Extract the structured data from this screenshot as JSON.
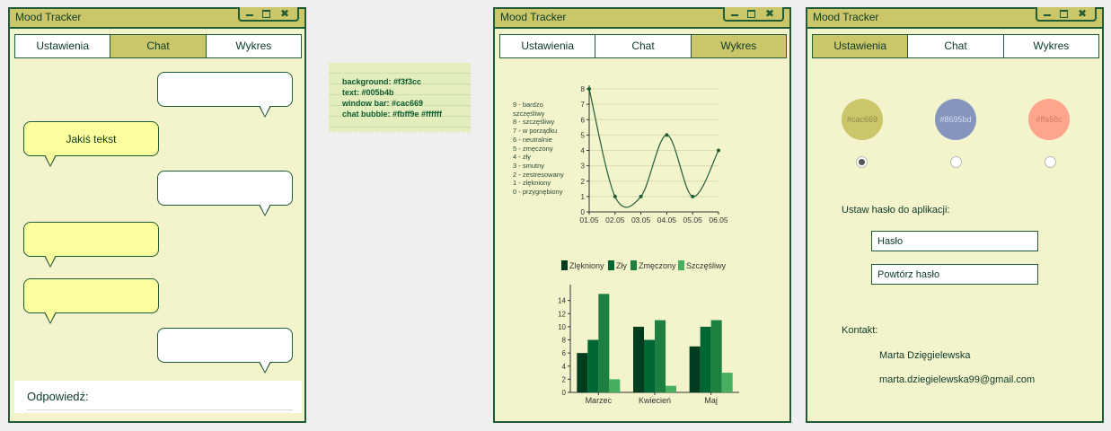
{
  "app_title": "Mood Tracker",
  "window_buttons": {
    "close_glyph": "✖"
  },
  "tabs": [
    "Ustawienia",
    "Chat",
    "Wykres"
  ],
  "chat": {
    "bubbles": [
      {
        "side": "right",
        "text": ""
      },
      {
        "side": "left",
        "text": "Jakiś tekst"
      },
      {
        "side": "right",
        "text": ""
      },
      {
        "side": "left",
        "text": ""
      },
      {
        "side": "left",
        "text": ""
      },
      {
        "side": "right",
        "text": ""
      }
    ],
    "reply_label": "Odpowiedź:"
  },
  "palette_note": {
    "lines": [
      "background: #f3f3cc",
      "text: #005b4b",
      "window bar: #cac669",
      "chat bubble: #fbff9e #ffffff"
    ]
  },
  "colors": {
    "background": "#f3f3cc",
    "text": "#005b4b",
    "window_bar": "#cac669",
    "bubble_other": "#fbff9e",
    "bubble_mine": "#ffffff"
  },
  "mood_scale": [
    "9 - bardzo",
    "szczęśliwy",
    "8 - szczęśliwy",
    "7 - w porządku",
    "6 - neutralnie",
    "5 - zmęczony",
    "4 - zły",
    "3 - smutny",
    "2 - zestresowany",
    "1 - zlękniony",
    "0 - przygnębiony"
  ],
  "chart_data": [
    {
      "type": "line",
      "x": [
        "01.05",
        "02.05",
        "03.05",
        "04.05",
        "05.05",
        "06.05"
      ],
      "series": [
        {
          "values": [
            8,
            1,
            1,
            5,
            1,
            4
          ]
        }
      ],
      "y_ticks": [
        "0",
        "1",
        "2",
        "3",
        "4",
        "5",
        "6",
        "7",
        "8"
      ],
      "ylim": [
        0,
        8
      ],
      "grid": true
    },
    {
      "type": "bar",
      "categories": [
        "Marzec",
        "Kwiecień",
        "Maj"
      ],
      "series": [
        {
          "name": "Zlękniony",
          "color": "#003d1f",
          "values": [
            6,
            10,
            7
          ]
        },
        {
          "name": "Zły",
          "color": "#006633",
          "values": [
            8,
            8,
            10
          ]
        },
        {
          "name": "Zmęczony",
          "color": "#1e8040",
          "values": [
            15,
            11,
            11
          ]
        },
        {
          "name": "Szczęśliwy",
          "color": "#46b060",
          "values": [
            2,
            1,
            3
          ]
        }
      ],
      "y_ticks": [
        "0",
        "2",
        "4",
        "6",
        "8",
        "10",
        "12",
        "14"
      ],
      "ylim": [
        0,
        16
      ],
      "legend": "top"
    }
  ],
  "settings": {
    "themes": [
      {
        "label": "#cac669",
        "color": "#cac669",
        "selected": true
      },
      {
        "label": "#8695bd",
        "color": "#8695bd",
        "selected": false
      },
      {
        "label": "#ffa58c",
        "color": "#ffa58c",
        "selected": false
      }
    ],
    "password_heading": "Ustaw hasło do aplikacji:",
    "password_placeholder": "Hasło",
    "repeat_placeholder": "Powtórz hasło",
    "contact_heading": "Kontakt:",
    "contact_name": "Marta Dzięgielewska",
    "contact_email": "marta.dziegielewska99@gmail.com"
  }
}
